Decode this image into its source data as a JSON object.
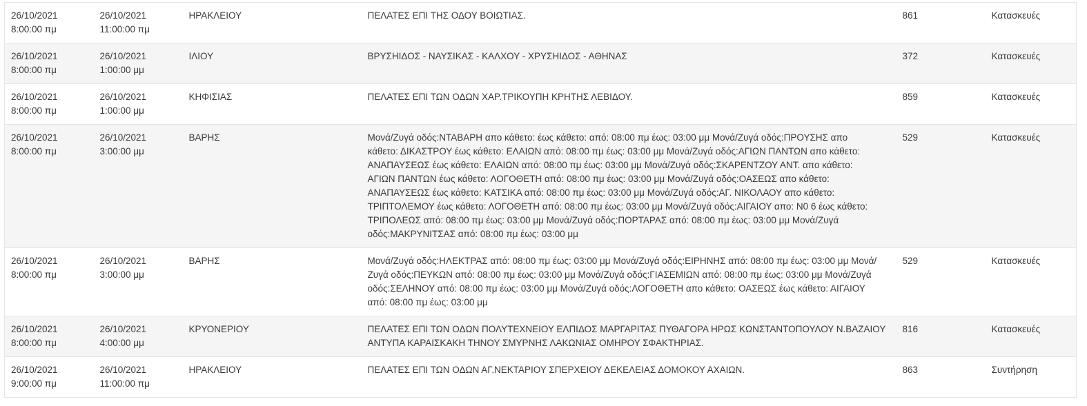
{
  "rows": [
    {
      "start_date": "26/10/2021",
      "start_time": "8:00:00 πμ",
      "end_date": "26/10/2021",
      "end_time": "11:00:00 πμ",
      "area": "ΗΡΑΚΛΕΙΟΥ",
      "description": "ΠΕΛΑΤΕΣ ΕΠΙ ΤΗΣ ΟΔΟΥ ΒΟΙΩΤΙΑΣ.",
      "code": "861",
      "type": "Κατασκευές"
    },
    {
      "start_date": "26/10/2021",
      "start_time": "8:00:00 πμ",
      "end_date": "26/10/2021",
      "end_time": "1:00:00 μμ",
      "area": "ΙΛΙΟΥ",
      "description": "ΒΡΥΣΗΙΔΟΣ - ΝΑΥΣΙΚΑΣ - ΚΑΛΧΟΥ - ΧΡΥΣΗΙΔΟΣ - ΑΘΗΝΑΣ",
      "code": "372",
      "type": "Κατασκευές"
    },
    {
      "start_date": "26/10/2021",
      "start_time": "8:00:00 πμ",
      "end_date": "26/10/2021",
      "end_time": "1:00:00 μμ",
      "area": "ΚΗΦΙΣΙΑΣ",
      "description": "ΠΕΛΑΤΕΣ ΕΠΙ ΤΩΝ ΟΔΩΝ ΧΑΡ.ΤΡΙΚΟΥΠΗ ΚΡΗΤΗΣ ΛΕΒΙΔΟΥ.",
      "code": "859",
      "type": "Κατασκευές"
    },
    {
      "start_date": "26/10/2021",
      "start_time": "8:00:00 πμ",
      "end_date": "26/10/2021",
      "end_time": "3:00:00 μμ",
      "area": "ΒΑΡΗΣ",
      "description_lines": [
        "Μονά/Ζυγά οδός:ΝΤΑΒΑΡΗ απο κάθετο: έως κάθετο: από: 08:00 πμ έως: 03:00 μμ Μονά/Ζυγά οδός:ΠΡΟΥΣΗΣ απο",
        "κάθετο: ΔΙΚΑΣΤΡΟΥ έως κάθετο: ΕΛΑΙΩΝ από: 08:00 πμ έως: 03:00 μμ Μονά/Ζυγά οδός:ΑΓΙΩΝ ΠΑΝΤΩΝ απο κάθετο:",
        "ΑΝΑΠΑΥΣΕΩΣ έως κάθετο: ΕΛΑΙΩΝ από: 08:00 πμ έως: 03:00 μμ Μονά/Ζυγά οδός:ΣΚΑΡΕΝΤΖΟΥ ΑΝΤ. απο κάθετο:",
        "ΑΓΙΩΝ ΠΑΝΤΩΝ έως κάθετο: ΛΟΓΟΘΕΤΗ από: 08:00 πμ έως: 03:00 μμ Μονά/Ζυγά οδός:ΟΑΣΕΩΣ απο κάθετο:",
        "ΑΝΑΠΑΥΣΕΩΣ έως κάθετο: ΚΑΤΣΙΚΑ από: 08:00 πμ έως: 03:00 μμ Μονά/Ζυγά οδός:ΑΓ. ΝΙΚΟΛΑΟΥ απο κάθετο:",
        "ΤΡΙΠΤΟΛΕΜΟΥ έως κάθετο: ΛΟΓΟΘΕΤΗ από: 08:00 πμ έως: 03:00 μμ Μονά/Ζυγά οδός:ΑΙΓΑΙΟΥ απο: Ν0 6 έως κάθετο:",
        "ΤΡΙΠΟΛΕΩΣ από: 08:00 πμ έως: 03:00 μμ Μονά/Ζυγά οδός:ΠΟΡΤΑΡΑΣ από: 08:00 πμ έως: 03:00 μμ Μονά/Ζυγά",
        "οδός:ΜΑΚΡΥΝΙΤΣΑΣ από: 08:00 πμ έως: 03:00 μμ"
      ],
      "code": "529",
      "type": "Κατασκευές"
    },
    {
      "start_date": "26/10/2021",
      "start_time": "8:00:00 πμ",
      "end_date": "26/10/2021",
      "end_time": "3:00:00 μμ",
      "area": "ΒΑΡΗΣ",
      "description_lines": [
        "Μονά/Ζυγά οδός:ΗΛΕΚΤΡΑΣ από: 08:00 πμ έως: 03:00 μμ Μονά/Ζυγά οδός:ΕΙΡΗΝΗΣ από: 08:00 πμ έως: 03:00 μμ Μονά/",
        "Ζυγά οδός:ΠΕΥΚΩΝ από: 08:00 πμ έως: 03:00 μμ Μονά/Ζυγά οδός:ΓΙΑΣΕΜΙΩΝ από: 08:00 πμ έως: 03:00 μμ Μονά/Ζυγά",
        "οδός:ΣΕΛΗΝΟΥ από: 08:00 πμ έως: 03:00 μμ Μονά/Ζυγά οδός:ΛΟΓΟΘΕΤΗ απο κάθετο: ΟΑΣΕΩΣ έως κάθετο: ΑΙΓΑΙΟΥ",
        "από: 08:00 πμ έως: 03:00 μμ"
      ],
      "code": "529",
      "type": "Κατασκευές"
    },
    {
      "start_date": "26/10/2021",
      "start_time": "8:00:00 πμ",
      "end_date": "26/10/2021",
      "end_time": "4:00:00 μμ",
      "area": "ΚΡΥΟΝΕΡΙΟΥ",
      "description_lines": [
        "ΠΕΛΑΤΕΣ ΕΠΙ ΤΩΝ ΟΔΩΝ ΠΟΛΥΤΕΧΝΕΙΟΥ ΕΛΠΙΔΟΣ ΜΑΡΓΑΡΙΤΑΣ ΠΥΘΑΓΟΡΑ ΗΡΩΣ ΚΩΝΣΤΑΝΤΟΠΟΥΛΟΥ Ν.ΒΑΖΑΙΟΥ",
        "ΑΝΤΥΠΑ ΚΑΡΑΙΣΚΑΚΗ ΤΗΝΟΥ ΣΜΥΡΝΗΣ ΛΑΚΩΝΙΑΣ ΟΜΗΡΟΥ ΣΦΑΚΤΗΡΙΑΣ."
      ],
      "code": "816",
      "type": "Κατασκευές"
    },
    {
      "start_date": "26/10/2021",
      "start_time": "9:00:00 πμ",
      "end_date": "26/10/2021",
      "end_time": "11:00:00 πμ",
      "area": "ΗΡΑΚΛΕΙΟΥ",
      "description": "ΠΕΛΑΤΕΣ ΕΠΙ ΤΩΝ ΟΔΩΝ ΑΓ.ΝΕΚΤΑΡΙΟΥ ΣΠΕΡΧΕΙΟΥ ΔΕΚΕΛΕΙΑΣ ΔΟΜΟΚΟΥ ΑΧΑΙΩΝ.",
      "code": "863",
      "type": "Συντήρηση"
    }
  ]
}
